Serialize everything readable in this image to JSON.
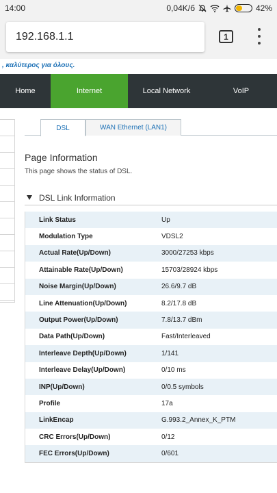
{
  "statusbar": {
    "time": "14:00",
    "network_speed": "0,04K/б",
    "battery_percent": "42%",
    "battery_level": 0.42
  },
  "browser": {
    "url": "192.168.1.1",
    "tab_count": "1"
  },
  "slogan": ", καλύτερος για όλους.",
  "nav": {
    "items": [
      {
        "label": "Home"
      },
      {
        "label": "Internet"
      },
      {
        "label": "Local Network"
      },
      {
        "label": "VoIP"
      }
    ],
    "active": "Internet"
  },
  "subtabs": {
    "items": [
      {
        "label": "DSL"
      },
      {
        "label": "WAN Ethernet (LAN1)"
      }
    ],
    "active": "DSL"
  },
  "page": {
    "title": "Page Information",
    "description": "This page shows the status of DSL."
  },
  "dsl_section": {
    "title": "DSL Link Information",
    "rows": [
      {
        "label": "Link Status",
        "value": "Up"
      },
      {
        "label": "Modulation Type",
        "value": "VDSL2"
      },
      {
        "label": "Actual Rate(Up/Down)",
        "value": "3000/27253 kbps"
      },
      {
        "label": "Attainable Rate(Up/Down)",
        "value": "15703/28924 kbps"
      },
      {
        "label": "Noise Margin(Up/Down)",
        "value": "26.6/9.7 dB"
      },
      {
        "label": "Line Attenuation(Up/Down)",
        "value": "8.2/17.8 dB"
      },
      {
        "label": "Output Power(Up/Down)",
        "value": "7.8/13.7 dBm"
      },
      {
        "label": "Data Path(Up/Down)",
        "value": "Fast/Interleaved"
      },
      {
        "label": "Interleave Depth(Up/Down)",
        "value": "1/141"
      },
      {
        "label": "Interleave Delay(Up/Down)",
        "value": "0/10 ms"
      },
      {
        "label": "INP(Up/Down)",
        "value": "0/0.5 symbols"
      },
      {
        "label": "Profile",
        "value": "17a"
      },
      {
        "label": "LinkEncap",
        "value": "G.993.2_Annex_K_PTM"
      },
      {
        "label": "CRC Errors(Up/Down)",
        "value": "0/12"
      },
      {
        "label": "FEC Errors(Up/Down)",
        "value": "0/601"
      }
    ]
  }
}
